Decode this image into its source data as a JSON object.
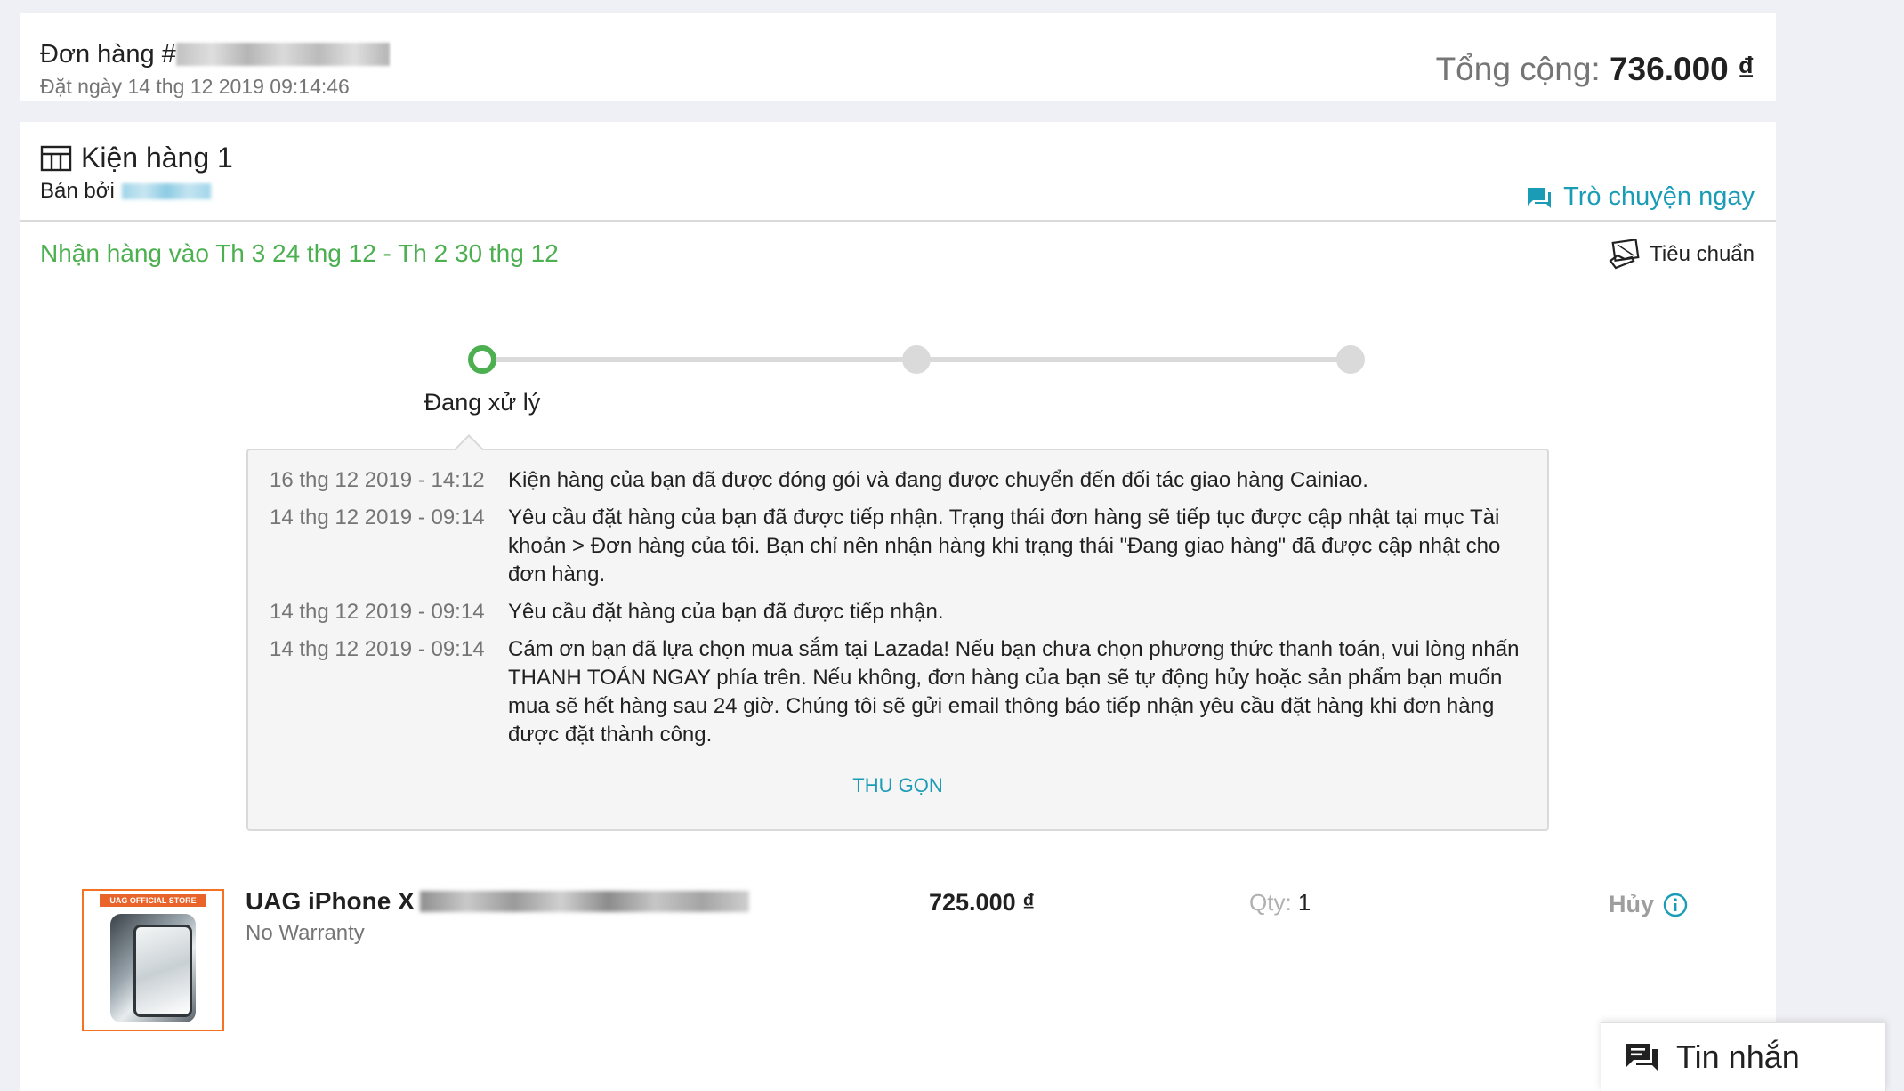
{
  "order": {
    "number_label": "Đơn hàng #",
    "placed_label": "Đặt ngày 14 thg 12 2019 09:14:46",
    "total_label": "Tổng cộng:",
    "total_value": "736.000 ₫"
  },
  "package": {
    "title": "Kiện hàng 1",
    "seller_label": "Bán bởi",
    "chat_label": "Trò chuyện ngay",
    "delivery_range": "Nhận hàng vào Th 3 24 thg 12 - Th 2 30 thg 12",
    "shipping_type": "Tiêu chuẩn",
    "status_label": "Đang xử lý",
    "timeline": [
      {
        "time": "16 thg 12 2019 - 14:12",
        "text": "Kiện hàng của bạn đã được đóng gói và đang được chuyển đến đối tác giao hàng Cainiao."
      },
      {
        "time": "14 thg 12 2019 - 09:14",
        "text": "Yêu cầu đặt hàng của bạn đã được tiếp nhận. Trạng thái đơn hàng sẽ tiếp tục được cập nhật tại mục Tài khoản > Đơn hàng của tôi. Bạn chỉ nên nhận hàng khi trạng thái \"Đang giao hàng\" đã được cập nhật cho đơn hàng."
      },
      {
        "time": "14 thg 12 2019 - 09:14",
        "text": "Yêu cầu đặt hàng của bạn đã được tiếp nhận."
      },
      {
        "time": "14 thg 12 2019 - 09:14",
        "text": "Cám ơn bạn đã lựa chọn mua sắm tại Lazada! Nếu bạn chưa chọn phương thức thanh toán, vui lòng nhấn THANH TOÁN NGAY phía trên. Nếu không, đơn hàng của bạn sẽ tự động hủy hoặc sản phẩm bạn muốn mua sẽ hết hàng sau 24 giờ. Chúng tôi sẽ gửi email thông báo tiếp nhận yêu cầu đặt hàng khi đơn hàng được đặt thành công."
      }
    ],
    "collapse_label": "THU GỌN",
    "progress_step": 1,
    "progress_steps": 3
  },
  "item": {
    "store_tag": "UAG OFFICIAL STORE",
    "name": "UAG iPhone X",
    "warranty": "No Warranty",
    "price": "725.000 ₫",
    "qty_label": "Qty:",
    "qty_value": "1",
    "status": "Hủy"
  },
  "messages_widget": {
    "label": "Tin nhắn"
  },
  "colors": {
    "accent_link": "#1a9cb7",
    "success_green": "#4caf50",
    "thumb_border": "#f57224",
    "page_bg": "#eff0f5"
  }
}
